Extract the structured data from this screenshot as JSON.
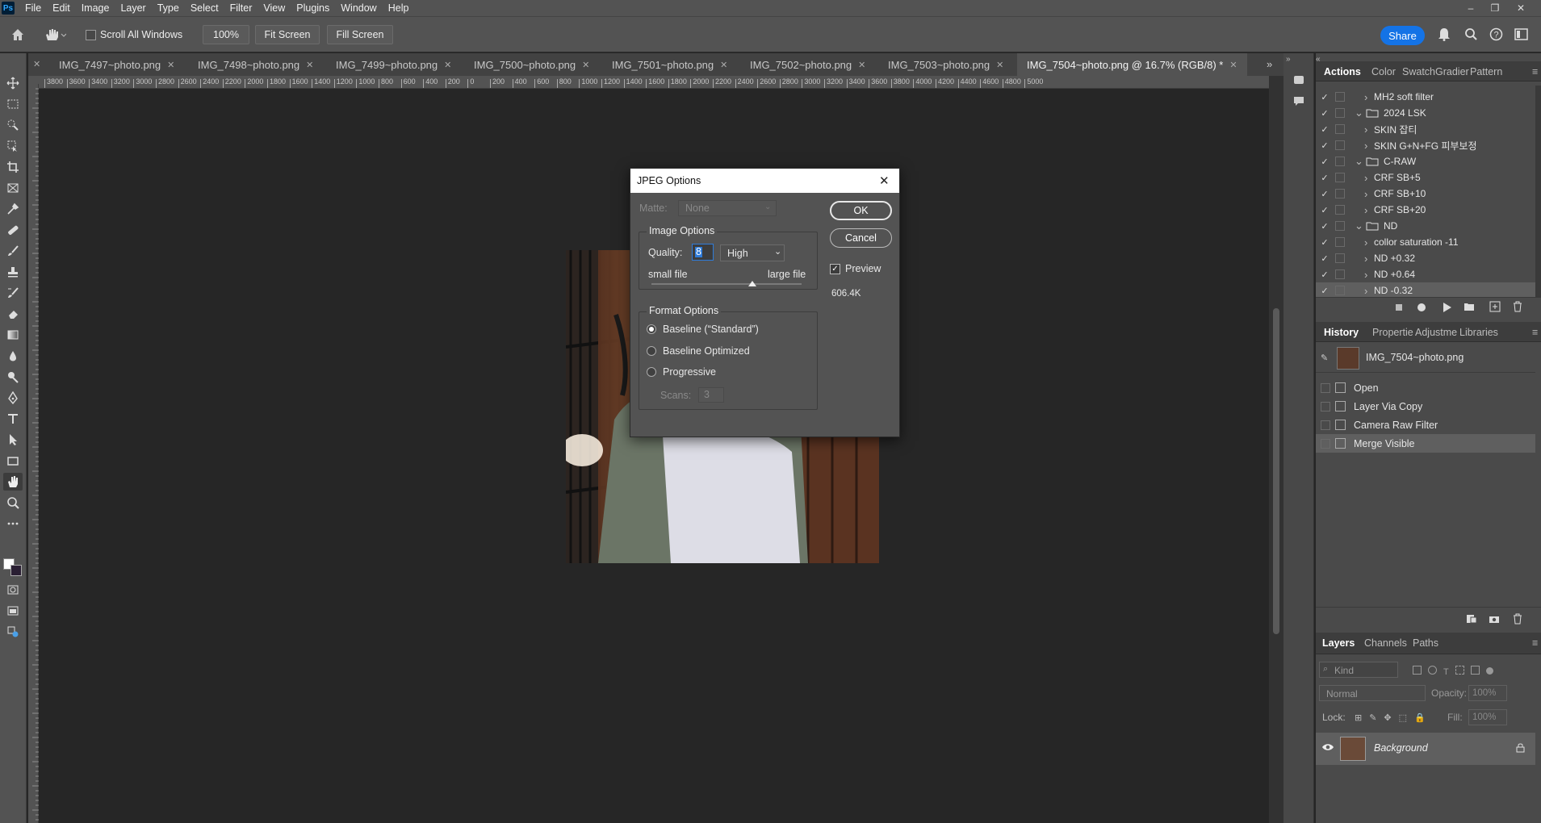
{
  "app": {
    "logo_text": "Ps"
  },
  "menubar": {
    "items": [
      "File",
      "Edit",
      "Image",
      "Layer",
      "Type",
      "Select",
      "Filter",
      "View",
      "Plugins",
      "Window",
      "Help"
    ]
  },
  "window_controls": {
    "minimize": "–",
    "restore": "❐",
    "close": "✕"
  },
  "options_bar": {
    "scroll_all_windows": "Scroll All Windows",
    "scroll_all_checked": false,
    "zoom_value": "100%",
    "fit_screen": "Fit Screen",
    "fill_screen": "Fill Screen",
    "share": "Share"
  },
  "tabs": [
    {
      "label": "IMG_7497~photo.png",
      "active": false
    },
    {
      "label": "IMG_7498~photo.png",
      "active": false
    },
    {
      "label": "IMG_7499~photo.png",
      "active": false
    },
    {
      "label": "IMG_7500~photo.png",
      "active": false
    },
    {
      "label": "IMG_7501~photo.png",
      "active": false
    },
    {
      "label": "IMG_7502~photo.png",
      "active": false
    },
    {
      "label": "IMG_7503~photo.png",
      "active": false
    },
    {
      "label": "IMG_7504~photo.png @ 16.7% (RGB/8) *",
      "active": true
    }
  ],
  "ruler": {
    "labels": [
      "3800",
      "3600",
      "3400",
      "3200",
      "3000",
      "2800",
      "2600",
      "2400",
      "2200",
      "2000",
      "1800",
      "1600",
      "1400",
      "1200",
      "1000",
      "800",
      "600",
      "400",
      "200",
      "0",
      "200",
      "400",
      "600",
      "800",
      "1000",
      "1200",
      "1400",
      "1600",
      "1800",
      "2000",
      "2200",
      "2400",
      "2600",
      "2800",
      "3000",
      "3200",
      "3400",
      "3600",
      "3800",
      "4000",
      "4200",
      "4400",
      "4600",
      "4800",
      "5000"
    ]
  },
  "dialog": {
    "title": "JPEG Options",
    "matte_label": "Matte:",
    "matte_value": "None",
    "image_options_label": "Image Options",
    "quality_label": "Quality:",
    "quality_value": "8",
    "quality_preset": "High",
    "small_file": "small file",
    "large_file": "large file",
    "quality_slider_fraction": 0.67,
    "format_options_label": "Format Options",
    "format_options": [
      {
        "label": "Baseline (“Standard”)",
        "selected": true
      },
      {
        "label": "Baseline Optimized",
        "selected": false
      },
      {
        "label": "Progressive",
        "selected": false
      }
    ],
    "scans_label": "Scans:",
    "scans_value": "3",
    "ok": "OK",
    "cancel": "Cancel",
    "preview_label": "Preview",
    "preview_checked": true,
    "file_size": "606.4K"
  },
  "actions_panel": {
    "tabs": [
      "Actions",
      "Color",
      "Swatch",
      "Gradier",
      "Pattern"
    ],
    "rows": [
      {
        "label": "MH2 soft filter",
        "type": "action",
        "indent": 2
      },
      {
        "label": "2024 LSK",
        "type": "set",
        "indent": 1,
        "expanded": true
      },
      {
        "label": "SKIN 잡티",
        "type": "action",
        "indent": 2
      },
      {
        "label": "SKIN G+N+FG 피부보정",
        "type": "action",
        "indent": 2
      },
      {
        "label": "C-RAW",
        "type": "set",
        "indent": 1,
        "expanded": true
      },
      {
        "label": "CRF SB+5",
        "type": "action",
        "indent": 2
      },
      {
        "label": "CRF SB+10",
        "type": "action",
        "indent": 2
      },
      {
        "label": "CRF SB+20",
        "type": "action",
        "indent": 2
      },
      {
        "label": "ND",
        "type": "set",
        "indent": 1,
        "expanded": true
      },
      {
        "label": "collor saturation -11",
        "type": "action",
        "indent": 2
      },
      {
        "label": "ND +0.32",
        "type": "action",
        "indent": 2
      },
      {
        "label": "ND +0.64",
        "type": "action",
        "indent": 2
      },
      {
        "label": "ND -0.32",
        "type": "action",
        "indent": 2,
        "selected": true
      }
    ]
  },
  "history_panel": {
    "tabs": [
      "History",
      "Propertie",
      "Adjustme",
      "Libraries"
    ],
    "snapshot": "IMG_7504~photo.png",
    "states": [
      {
        "label": "Open",
        "selected": false
      },
      {
        "label": "Layer Via Copy",
        "selected": false
      },
      {
        "label": "Camera Raw Filter",
        "selected": false
      },
      {
        "label": "Merge Visible",
        "selected": true
      }
    ]
  },
  "layers_panel": {
    "tabs": [
      "Layers",
      "Channels",
      "Paths"
    ],
    "kind_placeholder": "Kind",
    "blend_mode": "Normal",
    "opacity_label": "Opacity:",
    "opacity_value": "100%",
    "lock_label": "Lock:",
    "fill_label": "Fill:",
    "fill_value": "100%",
    "layers": [
      {
        "name": "Background",
        "visible": true,
        "locked": true
      }
    ]
  },
  "colors": {
    "accent": "#1473e6",
    "panel_bg": "#535353",
    "canvas_bg": "#262626"
  }
}
